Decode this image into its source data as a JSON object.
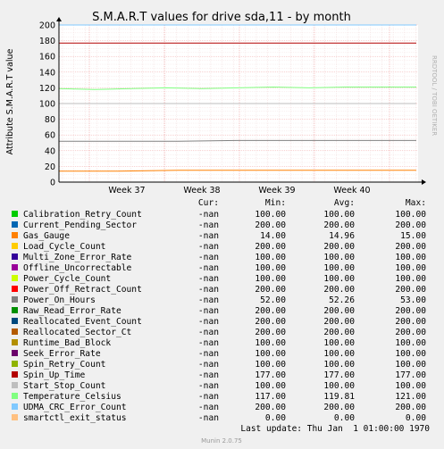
{
  "chart_data": {
    "type": "line",
    "title": "S.M.A.R.T values for drive sda,11 - by month",
    "ylabel": "Attribute S.M.A.R.T value",
    "xlabel": "",
    "ylim": [
      0,
      200
    ],
    "yticks": [
      0,
      20,
      40,
      60,
      80,
      100,
      120,
      140,
      160,
      180,
      200
    ],
    "ytick_labels": [
      "0",
      "20",
      "40",
      "60",
      "80",
      "100",
      "120",
      "140",
      "160",
      "180",
      "200"
    ],
    "xticks": [
      "Week 37",
      "Week 38",
      "Week 39",
      "Week 40"
    ],
    "grid": true,
    "watermark": "RRDTOOL / TOBI OETIKER",
    "legend_headers": [
      "Cur:",
      "Min:",
      "Avg:",
      "Max:"
    ],
    "series": [
      {
        "name": "Calibration_Retry_Count",
        "color": "#00cc00",
        "cur": "-nan",
        "min": "100.00",
        "avg": "100.00",
        "max": "100.00",
        "values": [
          100,
          100
        ]
      },
      {
        "name": "Current_Pending_Sector",
        "color": "#0066b3",
        "cur": "-nan",
        "min": "200.00",
        "avg": "200.00",
        "max": "200.00",
        "values": [
          200,
          200
        ]
      },
      {
        "name": "Gas_Gauge",
        "color": "#ff8000",
        "cur": "-nan",
        "min": "14.00",
        "avg": "14.96",
        "max": "15.00",
        "values": [
          14,
          14,
          15,
          15,
          15,
          15,
          15
        ]
      },
      {
        "name": "Load_Cycle_Count",
        "color": "#ffcc00",
        "cur": "-nan",
        "min": "200.00",
        "avg": "200.00",
        "max": "200.00",
        "values": [
          200,
          200
        ]
      },
      {
        "name": "Multi_Zone_Error_Rate",
        "color": "#330099",
        "cur": "-nan",
        "min": "100.00",
        "avg": "100.00",
        "max": "100.00",
        "values": [
          100,
          100
        ]
      },
      {
        "name": "Offline_Uncorrectable",
        "color": "#990099",
        "cur": "-nan",
        "min": "100.00",
        "avg": "100.00",
        "max": "100.00",
        "values": [
          100,
          100
        ]
      },
      {
        "name": "Power_Cycle_Count",
        "color": "#ccff00",
        "cur": "-nan",
        "min": "100.00",
        "avg": "100.00",
        "max": "100.00",
        "values": [
          100,
          100
        ]
      },
      {
        "name": "Power_Off_Retract_Count",
        "color": "#ff0000",
        "cur": "-nan",
        "min": "200.00",
        "avg": "200.00",
        "max": "200.00",
        "values": [
          200,
          200
        ]
      },
      {
        "name": "Power_On_Hours",
        "color": "#808080",
        "cur": "-nan",
        "min": "52.00",
        "avg": "52.26",
        "max": "53.00",
        "values": [
          52,
          52,
          52,
          53,
          53,
          53,
          53
        ]
      },
      {
        "name": "Raw_Read_Error_Rate",
        "color": "#008f00",
        "cur": "-nan",
        "min": "200.00",
        "avg": "200.00",
        "max": "200.00",
        "values": [
          200,
          200
        ]
      },
      {
        "name": "Reallocated_Event_Count",
        "color": "#00487d",
        "cur": "-nan",
        "min": "200.00",
        "avg": "200.00",
        "max": "200.00",
        "values": [
          200,
          200
        ]
      },
      {
        "name": "Reallocated_Sector_Ct",
        "color": "#b35a00",
        "cur": "-nan",
        "min": "200.00",
        "avg": "200.00",
        "max": "200.00",
        "values": [
          200,
          200
        ]
      },
      {
        "name": "Runtime_Bad_Block",
        "color": "#b38f00",
        "cur": "-nan",
        "min": "100.00",
        "avg": "100.00",
        "max": "100.00",
        "values": [
          100,
          100
        ]
      },
      {
        "name": "Seek_Error_Rate",
        "color": "#6b006b",
        "cur": "-nan",
        "min": "100.00",
        "avg": "100.00",
        "max": "100.00",
        "values": [
          100,
          100
        ]
      },
      {
        "name": "Spin_Retry_Count",
        "color": "#8fb300",
        "cur": "-nan",
        "min": "100.00",
        "avg": "100.00",
        "max": "100.00",
        "values": [
          100,
          100
        ]
      },
      {
        "name": "Spin_Up_Time",
        "color": "#b30000",
        "cur": "-nan",
        "min": "177.00",
        "avg": "177.00",
        "max": "177.00",
        "values": [
          177,
          177
        ]
      },
      {
        "name": "Start_Stop_Count",
        "color": "#bebebe",
        "cur": "-nan",
        "min": "100.00",
        "avg": "100.00",
        "max": "100.00",
        "values": [
          100,
          100
        ]
      },
      {
        "name": "Temperature_Celsius",
        "color": "#80ff80",
        "cur": "-nan",
        "min": "117.00",
        "avg": "119.81",
        "max": "121.00",
        "values": [
          119,
          118,
          119,
          120,
          119,
          120,
          121,
          120,
          121,
          121,
          121
        ]
      },
      {
        "name": "UDMA_CRC_Error_Count",
        "color": "#80c9ff",
        "cur": "-nan",
        "min": "200.00",
        "avg": "200.00",
        "max": "200.00",
        "values": [
          200,
          200
        ]
      },
      {
        "name": "smartctl_exit_status",
        "color": "#ffc080",
        "cur": "-nan",
        "min": "0.00",
        "avg": "0.00",
        "max": "0.00",
        "values": [
          0,
          0
        ]
      }
    ],
    "last_update": "Last update: Thu Jan  1 01:00:00 1970",
    "footer": "Munin 2.0.75"
  }
}
